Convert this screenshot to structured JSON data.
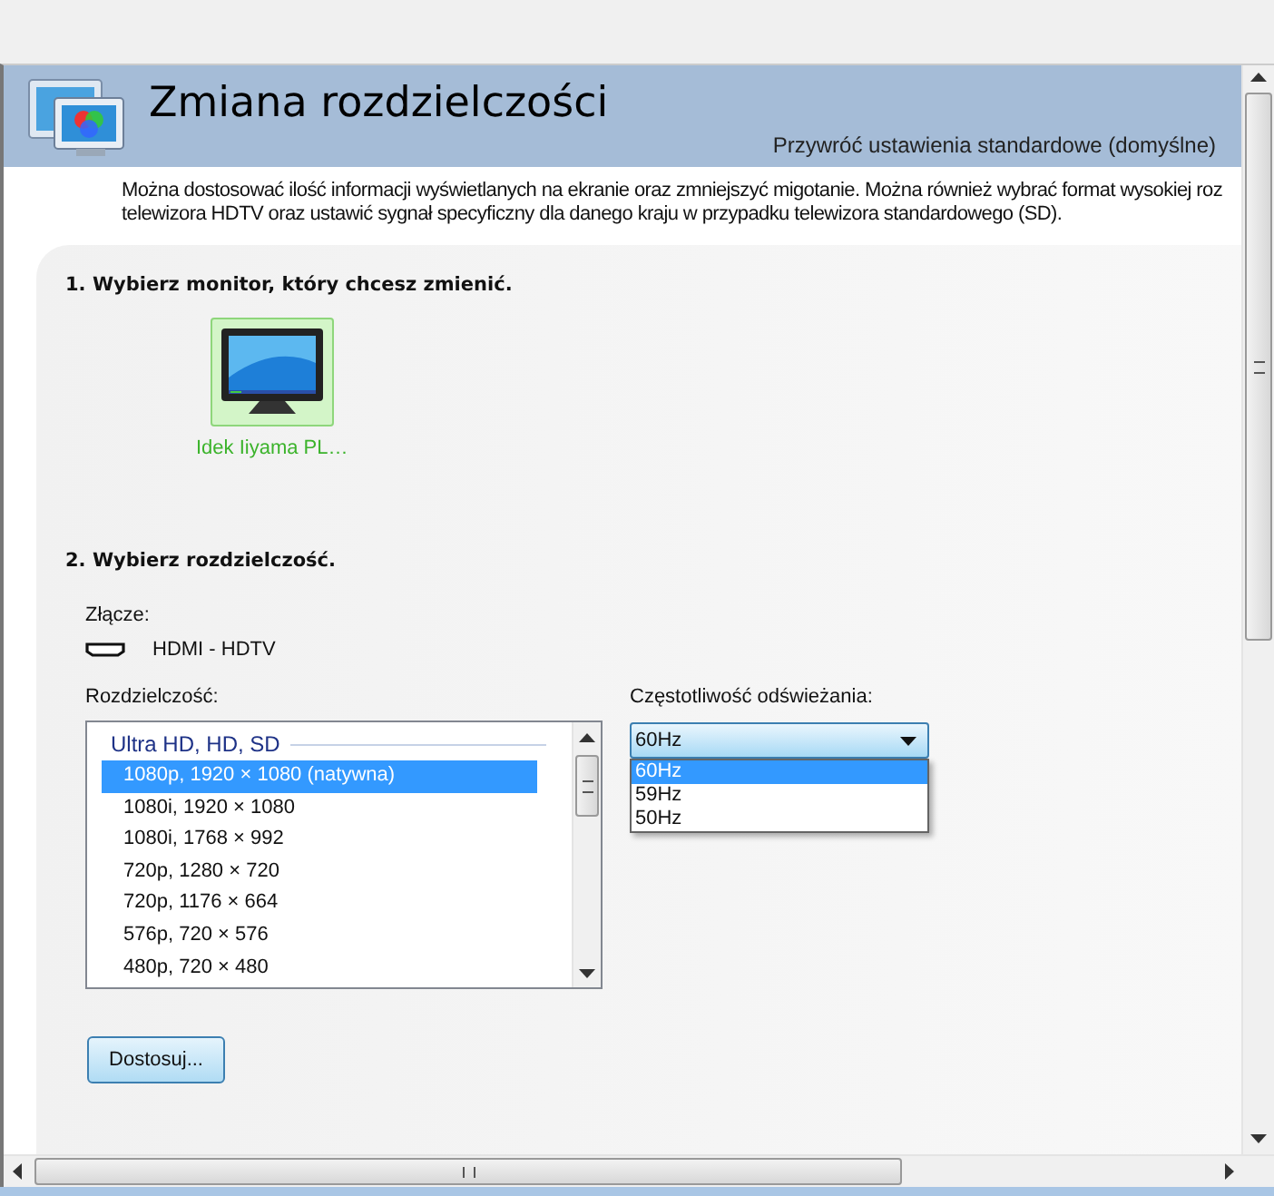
{
  "header": {
    "title": "Zmiana rozdzielczości",
    "restore_link": "Przywróć ustawienia standardowe (domyślne)"
  },
  "description": [
    "Można dostosować ilość informacji wyświetlanych na ekranie oraz zmniejszyć migotanie. Można również wybrać format wysokiej roz",
    "telewizora HDTV oraz ustawić sygnał specyficzny dla danego kraju w przypadku telewizora standardowego (SD)."
  ],
  "step1": {
    "heading": "1. Wybierz monitor, który chcesz zmienić.",
    "monitors": [
      {
        "label": "Idek Iiyama PL…",
        "selected": true
      }
    ]
  },
  "step2": {
    "heading": "2. Wybierz rozdzielczość.",
    "connector_label": "Złącze:",
    "connector": "HDMI - HDTV",
    "resolution_label": "Rozdzielczość:",
    "resolution_group": "Ultra HD, HD, SD",
    "resolutions": [
      {
        "label": "1080p, 1920 × 1080 (natywna)",
        "selected": true
      },
      {
        "label": "1080i, 1920 × 1080",
        "selected": false
      },
      {
        "label": "1080i, 1768 × 992",
        "selected": false
      },
      {
        "label": "720p, 1280 × 720",
        "selected": false
      },
      {
        "label": "720p, 1176 × 664",
        "selected": false
      },
      {
        "label": "576p, 720 × 576",
        "selected": false
      },
      {
        "label": "480p, 720 × 480",
        "selected": false
      }
    ],
    "refresh_label": "Częstotliwość odświeżania:",
    "refresh_value": "60Hz",
    "refresh_options": [
      {
        "label": "60Hz",
        "selected": true
      },
      {
        "label": "59Hz",
        "selected": false
      },
      {
        "label": "50Hz",
        "selected": false
      }
    ]
  },
  "customize_button": "Dostosuj..."
}
